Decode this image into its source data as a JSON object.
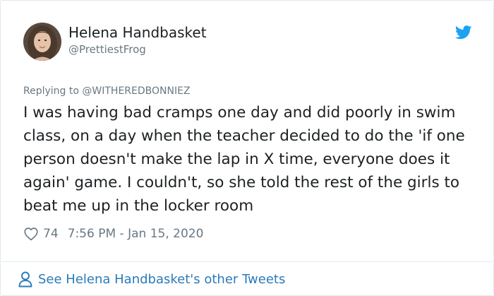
{
  "tweet": {
    "author_name": "Helena Handbasket",
    "author_handle": "@PrettiestFrog",
    "replying_prefix": "Replying to",
    "replying_to": "@WITHEREDBONNIEZ",
    "text": "I was having bad cramps one day and did poorly in swim class, on a day when the teacher decided to do the 'if one person doesn't make the lap in X time, everyone does it again' game. I couldn't, so she told the rest of the girls to beat me up in the locker room",
    "like_count": "74",
    "timestamp": "7:56 PM - Jan 15, 2020"
  },
  "footer": {
    "link_text": "See Helena Handbasket's other Tweets"
  },
  "icons": {
    "brand": "twitter-bird-icon",
    "like": "heart-icon",
    "profile": "person-icon"
  },
  "colors": {
    "twitter_blue": "#1da1f2",
    "link_blue": "#2b7bb9",
    "secondary_text": "#697882",
    "primary_text": "#1c2022",
    "border": "#e1e8ed"
  }
}
